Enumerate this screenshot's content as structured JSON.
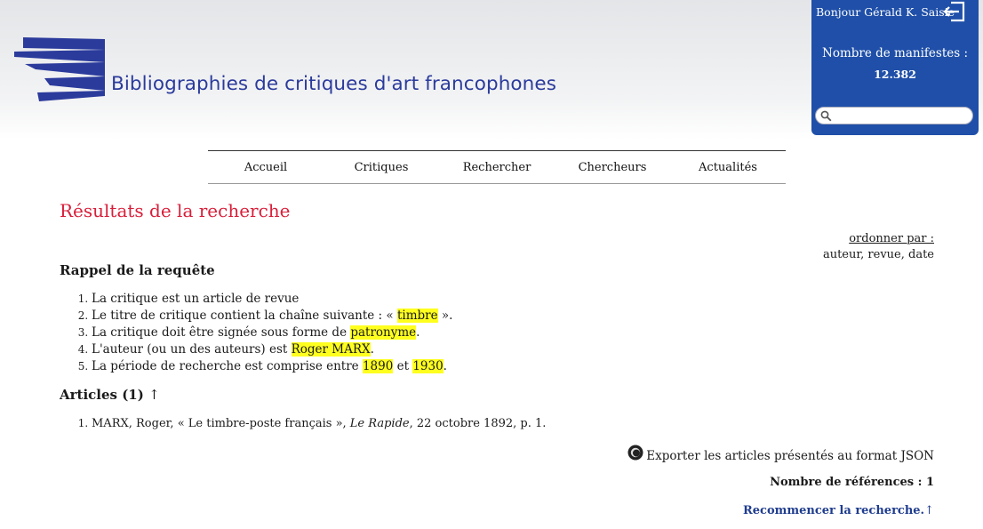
{
  "header": {
    "site_title": "Bibliographies de critiques d'art francophones"
  },
  "user_panel": {
    "greeting": "Bonjour Gérald K.  Saisie",
    "manifest_label": "Nombre de manifestes :",
    "manifest_count": "12.382",
    "search_value": "",
    "search_placeholder": ""
  },
  "nav": [
    {
      "label": "Accueil"
    },
    {
      "label": "Critiques"
    },
    {
      "label": "Rechercher"
    },
    {
      "label": "Chercheurs"
    },
    {
      "label": "Actualités"
    }
  ],
  "page_title": "Résultats de la recherche",
  "order": {
    "label": "ordonner par :",
    "options": "auteur, revue, date"
  },
  "recall": {
    "heading": "Rappel de la requête",
    "items": [
      {
        "text": "La critique est un article de revue"
      },
      {
        "before": "Le titre de critique contient la chaîne suivante : « ",
        "hl": "timbre",
        "after": " »."
      },
      {
        "before": "La critique doit être signée sous forme de ",
        "hl": "patronyme",
        "after": "."
      },
      {
        "before": "L'auteur (ou un des auteurs) est ",
        "hl": "Roger MARX",
        "after": "."
      },
      {
        "before": "La période de recherche est comprise entre ",
        "hl": "1890",
        "mid": " et ",
        "hl2": "1930",
        "after": "."
      }
    ]
  },
  "articles": {
    "heading": "Articles (1)",
    "arrow": "↑",
    "items": [
      {
        "before": "MARX, Roger, « Le timbre-poste français », ",
        "journal": "Le Rapide",
        "after": ", 22 octobre 1892, p. 1."
      }
    ]
  },
  "export_label": "Exporter les articles présentés au format JSON",
  "ref_count": "Nombre de références : 1",
  "restart": {
    "label": "Recommencer la recherche.",
    "arrow": "↑"
  },
  "colors": {
    "brand_blue": "#2b3b9c",
    "panel_blue": "#1f4fa8",
    "title_red": "#d81f3a",
    "highlight": "#ffff1f"
  }
}
